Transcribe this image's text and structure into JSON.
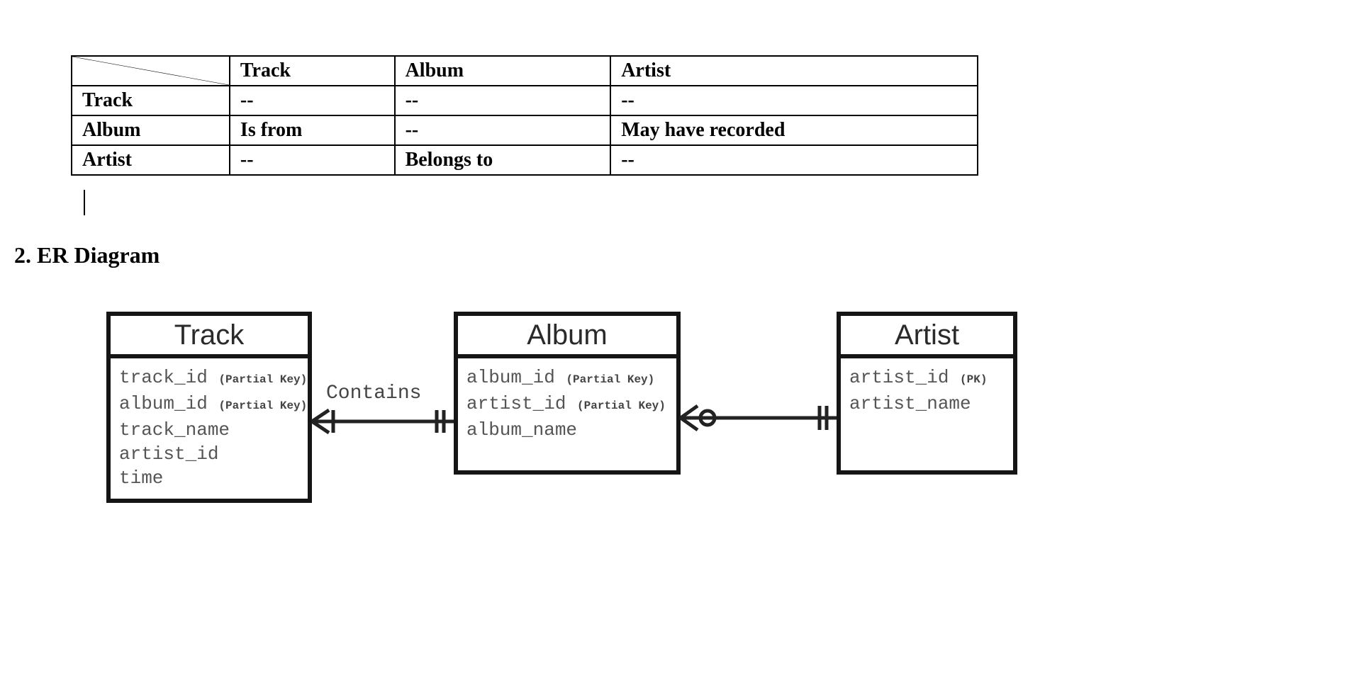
{
  "matrix": {
    "cols": [
      "Track",
      "Album",
      "Artist"
    ],
    "rows": [
      "Track",
      "Album",
      "Artist"
    ],
    "cells": {
      "r0c0": "--",
      "r0c1": "--",
      "r0c2": "--",
      "r1c0": "Is from",
      "r1c1": "--",
      "r1c2": "May have recorded",
      "r2c0": "--",
      "r2c1": "Belongs to",
      "r2c2": "--"
    }
  },
  "heading": "2. ER Diagram",
  "er": {
    "relationships": {
      "contains": "Contains"
    },
    "entities": {
      "track": {
        "title": "Track",
        "attrs": [
          {
            "name": "track_id",
            "note": "(Partial Key)"
          },
          {
            "name": "album_id",
            "note": "(Partial Key)"
          },
          {
            "name": "track_name",
            "note": ""
          },
          {
            "name": "artist_id",
            "note": ""
          },
          {
            "name": "time",
            "note": ""
          }
        ]
      },
      "album": {
        "title": "Album",
        "attrs": [
          {
            "name": "album_id",
            "note": "(Partial Key)"
          },
          {
            "name": "artist_id",
            "note": "(Partial Key)"
          },
          {
            "name": "album_name",
            "note": ""
          }
        ]
      },
      "artist": {
        "title": "Artist",
        "attrs": [
          {
            "name": "artist_id",
            "note": "(PK)"
          },
          {
            "name": "artist_name",
            "note": ""
          }
        ]
      }
    }
  }
}
